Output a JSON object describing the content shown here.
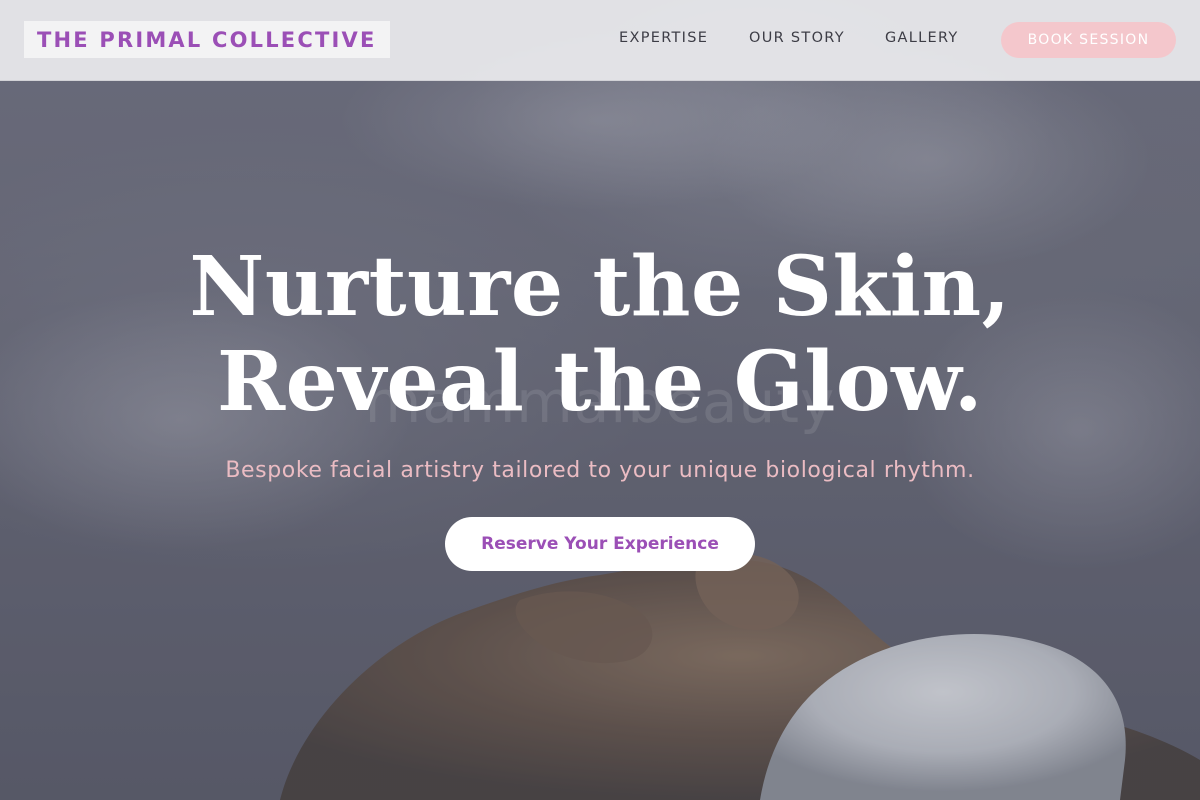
{
  "header": {
    "brand": "THE PRIMAL COLLECTIVE",
    "nav": [
      {
        "label": "EXPERTISE"
      },
      {
        "label": "OUR STORY"
      },
      {
        "label": "GALLERY"
      }
    ],
    "cta_label": "BOOK SESSION"
  },
  "hero": {
    "headline_line1": "Nurture the Skin,",
    "headline_line2": "Reveal the Glow.",
    "watermark": "mammalbeauty",
    "subtitle": "Bespoke facial artistry tailored to your unique biological rhythm.",
    "cta_label": "Reserve Your Experience",
    "background_image": "steam-facial-photo"
  },
  "colors": {
    "brand_purple": "#9b4fb6",
    "book_button_pink": "#f4c7cc",
    "subtitle_pink": "#ebbcc3",
    "header_background": "#e9e9ec"
  }
}
